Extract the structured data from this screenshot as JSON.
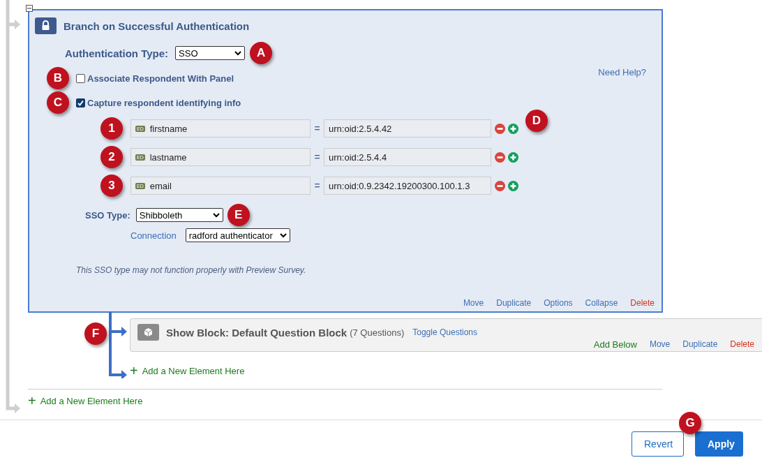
{
  "branch": {
    "title": "Branch on Successful Authentication",
    "auth_type": {
      "label": "Authentication Type:",
      "value": "SSO",
      "callout": "A"
    },
    "need_help": "Need Help?",
    "checkboxes": [
      {
        "label": "Associate Respondent With Panel",
        "checked": false,
        "callout": "B"
      },
      {
        "label": "Capture respondent identifying info",
        "checked": true,
        "callout": "C"
      }
    ],
    "mappings": [
      {
        "callout": "1",
        "tag": "ED",
        "field": "firstname",
        "equals": "=",
        "value": "urn:oid:2.5.4.42",
        "actions_callout": "D"
      },
      {
        "callout": "2",
        "tag": "ED",
        "field": "lastname",
        "equals": "=",
        "value": "urn:oid:2.5.4.4"
      },
      {
        "callout": "3",
        "tag": "ED",
        "field": "email",
        "equals": "=",
        "value": "urn:oid:0.9.2342.19200300.100.1.3"
      }
    ],
    "sso_type": {
      "label": "SSO Type:",
      "value": "Shibboleth",
      "callout": "E"
    },
    "connection": {
      "label": "Connection",
      "value": "radford authenticator"
    },
    "note": "This SSO type may not function properly with Preview Survey.",
    "actions": [
      {
        "label": "Move",
        "kind": "link"
      },
      {
        "label": "Duplicate",
        "kind": "link"
      },
      {
        "label": "Options",
        "kind": "link"
      },
      {
        "label": "Collapse",
        "kind": "link"
      },
      {
        "label": "Delete",
        "kind": "danger"
      }
    ]
  },
  "show_block": {
    "callout": "F",
    "title": "Show Block: Default Question Block",
    "count": "(7 Questions)",
    "toggle": "Toggle Questions",
    "actions": [
      {
        "label": "Add Below",
        "kind": "add"
      },
      {
        "label": "Move",
        "kind": "link"
      },
      {
        "label": "Duplicate",
        "kind": "link"
      },
      {
        "label": "Delete",
        "kind": "danger"
      }
    ]
  },
  "add_inner": {
    "icon": "+",
    "label": "Add a New Element Here"
  },
  "add_outer": {
    "icon": "+",
    "label": "Add a New Element Here"
  },
  "buttons": [
    {
      "label": "Revert",
      "kind": "secondary"
    },
    {
      "label": "Apply",
      "kind": "primary",
      "callout": "G"
    }
  ]
}
